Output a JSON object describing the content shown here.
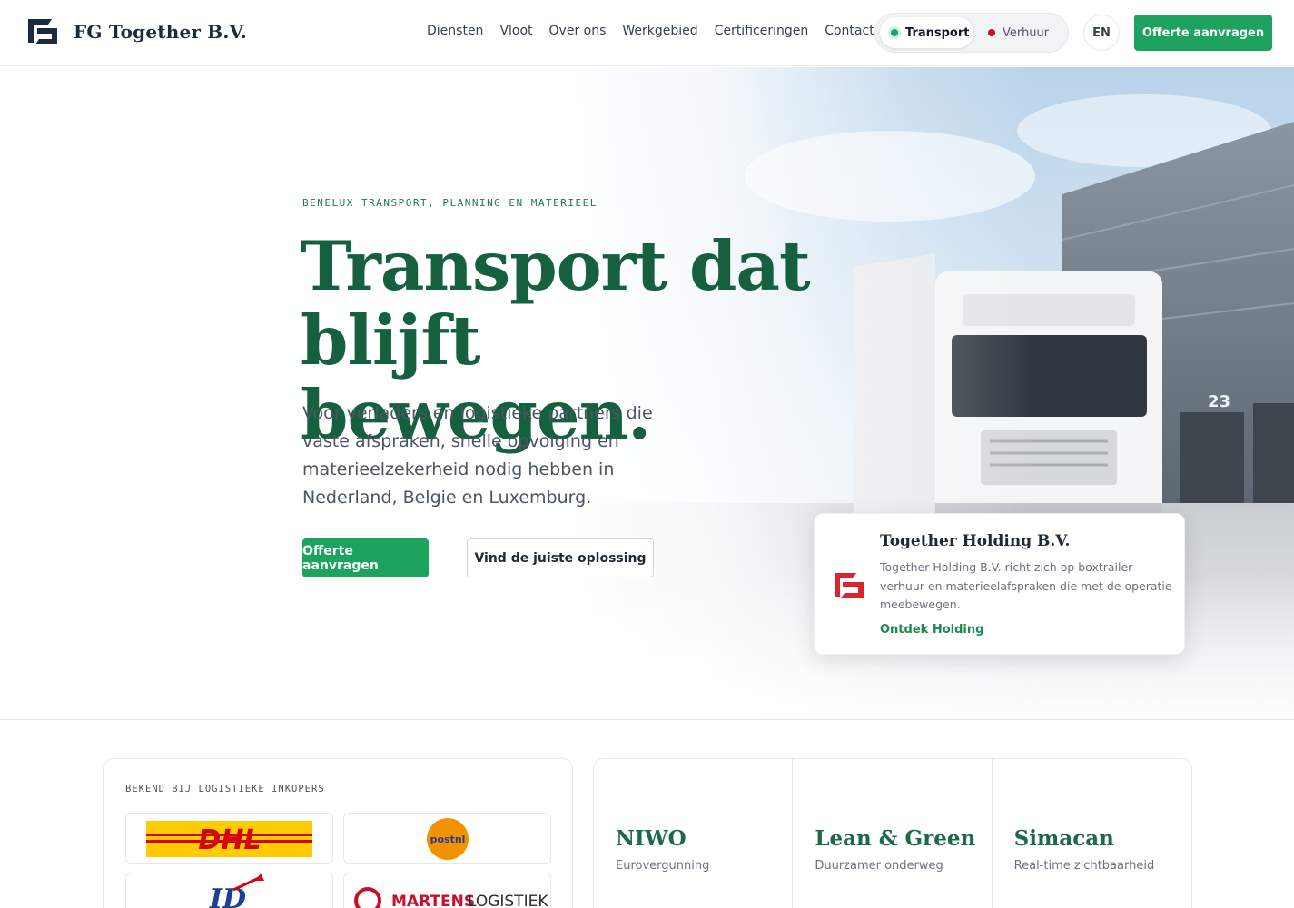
{
  "brand": {
    "name": "FG Together B.V."
  },
  "nav": {
    "items": [
      {
        "label": "Diensten"
      },
      {
        "label": "Vloot"
      },
      {
        "label": "Over ons"
      },
      {
        "label": "Werkgebied"
      },
      {
        "label": "Certificeringen"
      },
      {
        "label": "Contact"
      }
    ]
  },
  "mode_toggle": {
    "active": "Transport",
    "inactive": "Verhuur"
  },
  "language": "EN",
  "header_cta": "Offerte aanvragen",
  "hero": {
    "eyebrow": "BENELUX TRANSPORT, PLANNING EN MATERIEEL",
    "title_line1": "Transport dat",
    "title_line2": "blijft bewegen.",
    "lead": "Voor verladers en logistieke partners die vaste afspraken, snelle opvolging en materieelzekerheid nodig hebben in Nederland, Belgie en Luxemburg.",
    "primary_button": "Offerte aanvragen",
    "secondary_button": "Vind de juiste oplossing",
    "dock_number": "23"
  },
  "holding_card": {
    "title": "Together Holding B.V.",
    "text": "Together Holding B.V. richt zich op boxtrailer verhuur en materieelafspraken die met de operatie meebewegen.",
    "link": "Ontdek Holding"
  },
  "partners": {
    "label": "BEKEND BIJ LOGISTIEKE INKOPERS",
    "logos": [
      {
        "name": "DHL"
      },
      {
        "name": "postnl"
      },
      {
        "name": "ID"
      },
      {
        "name": "MARTENS",
        "suffix": "LOGISTIEK"
      }
    ]
  },
  "certifications": [
    {
      "name": "NIWO",
      "subtitle": "Eurovergunning"
    },
    {
      "name": "Lean & Green",
      "subtitle": "Duurzamer onderweg"
    },
    {
      "name": "Simacan",
      "subtitle": "Real-time zichtbaarheid"
    }
  ],
  "colors": {
    "primary_green": "#1ea35f",
    "heading_green": "#14603f",
    "brand_navy": "#1b2a3d",
    "holding_red": "#d7262e"
  }
}
